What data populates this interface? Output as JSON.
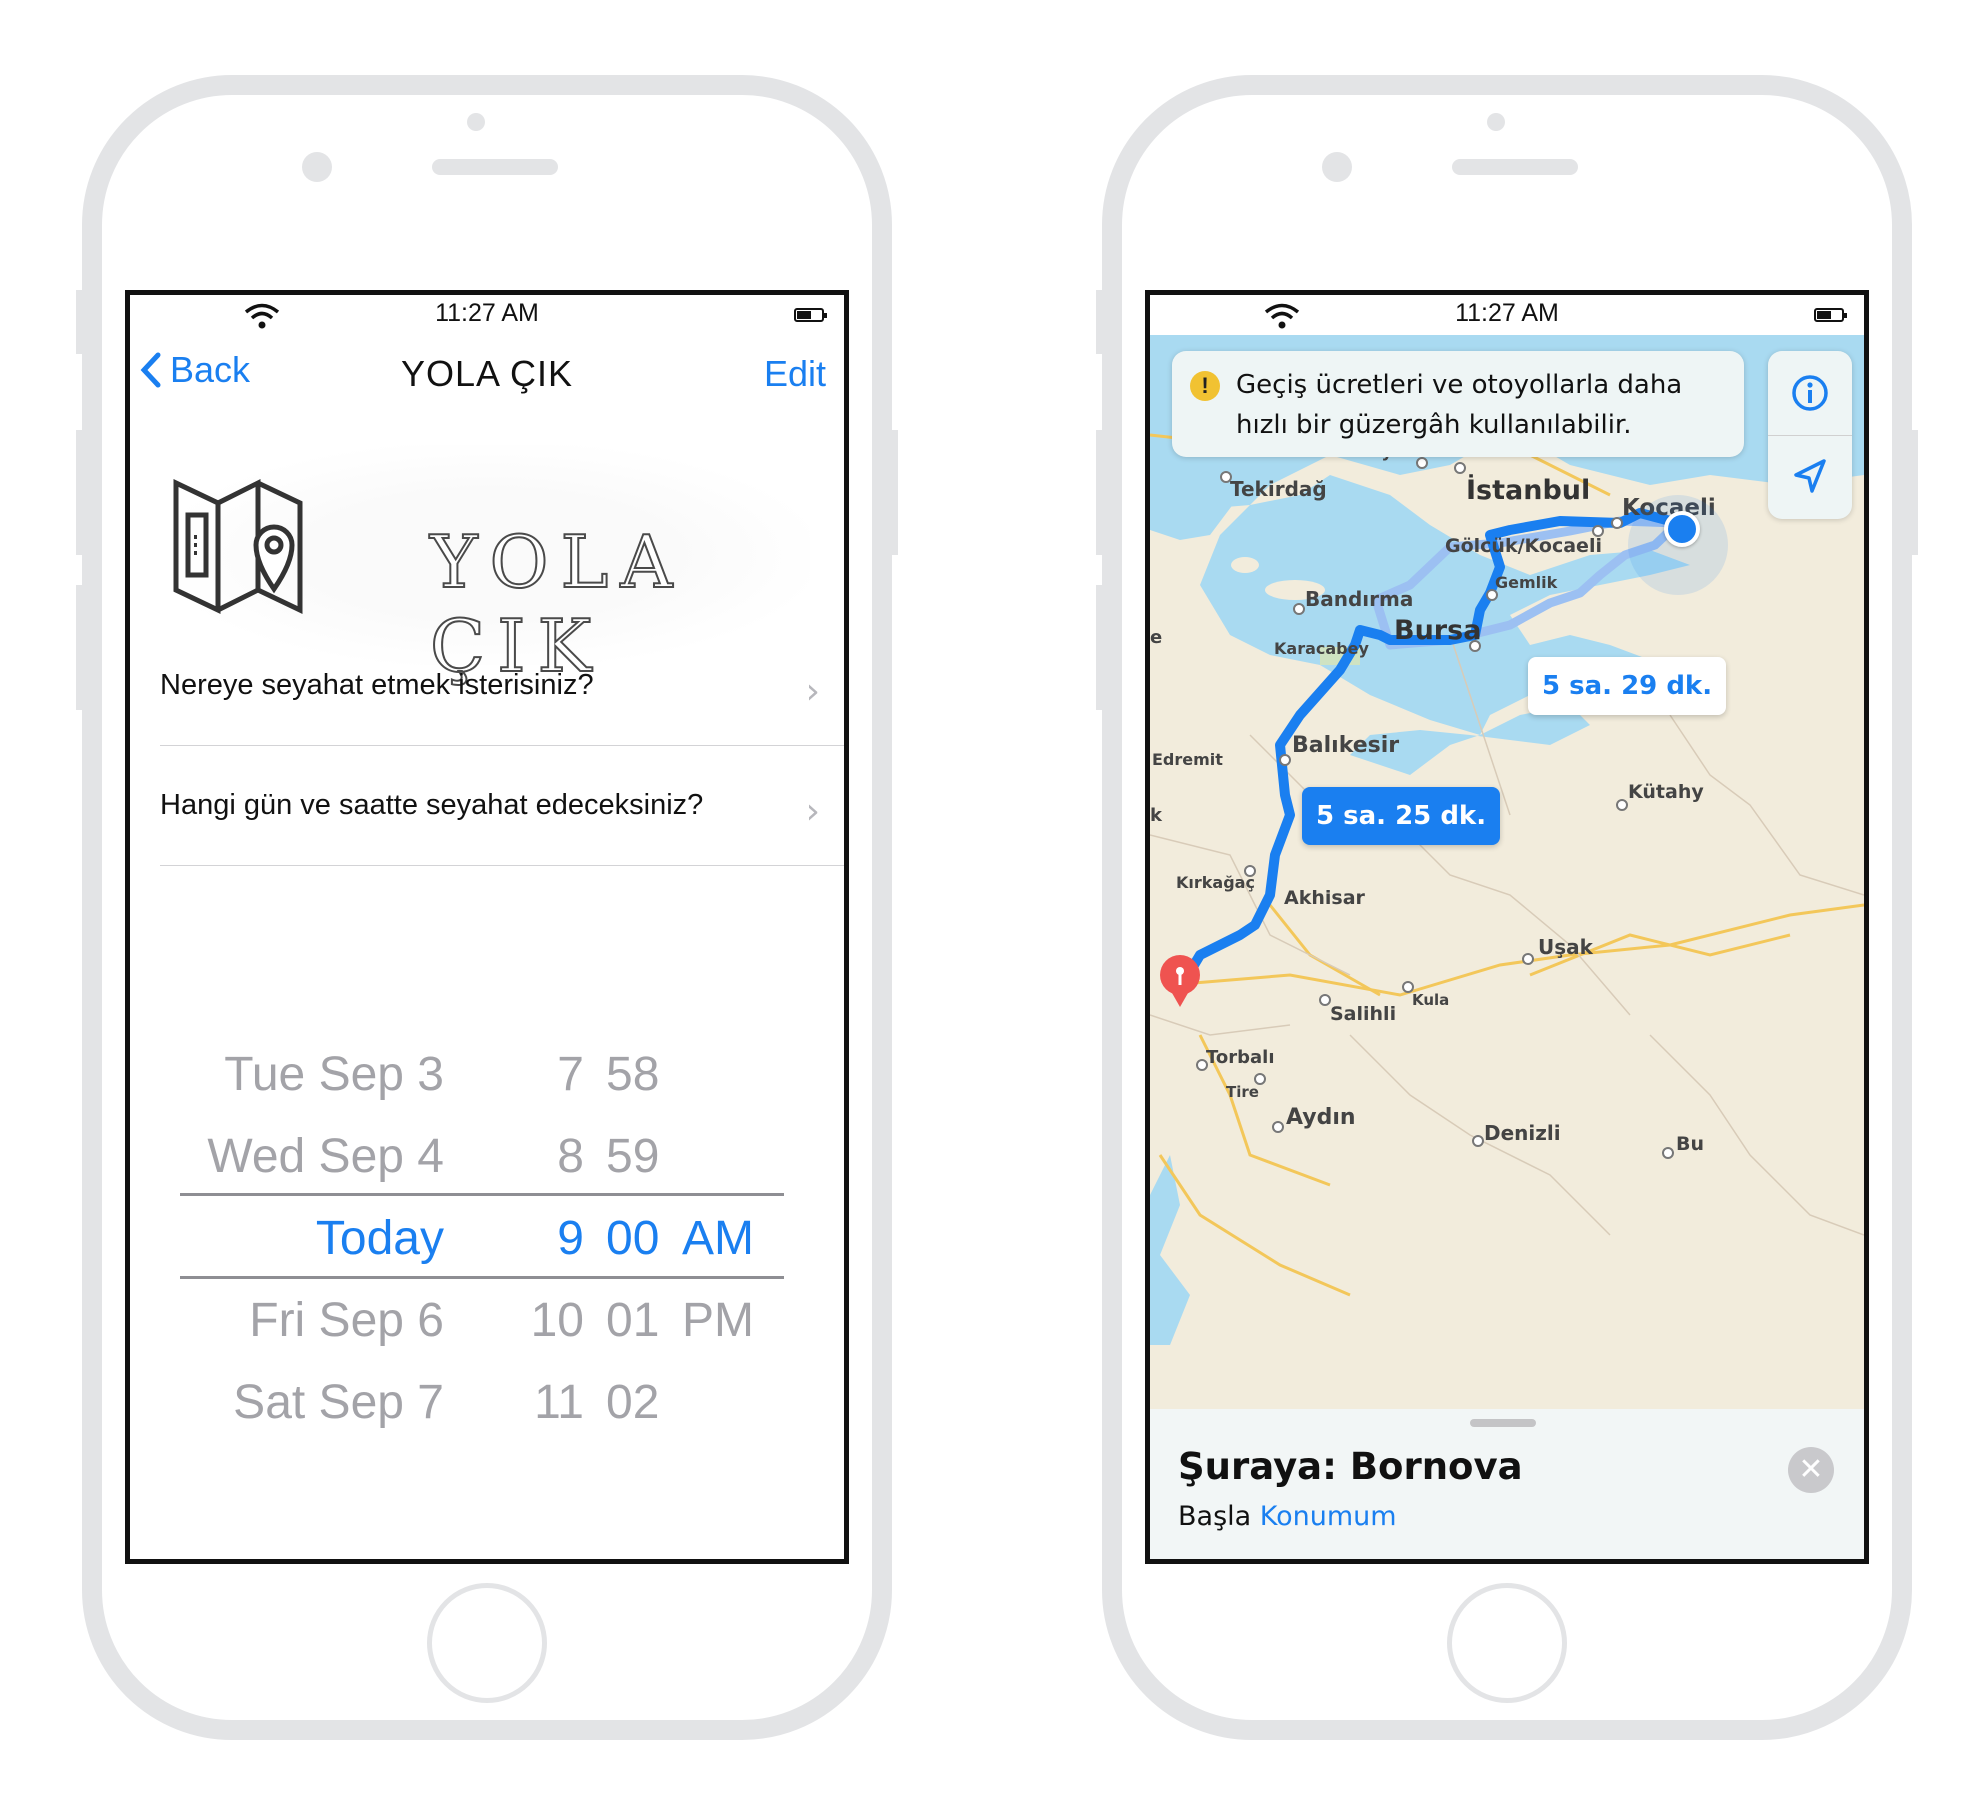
{
  "left_phone": {
    "status": {
      "time": "11:27 AM"
    },
    "nav": {
      "back": "Back",
      "title": "YOLA ÇIK",
      "edit": "Edit"
    },
    "logo": {
      "text": "YOLA ÇIK",
      "icon": "folded-map-pin-icon"
    },
    "rows": [
      {
        "label": "Nereye seyahat etmek isterisiniz?"
      },
      {
        "label": "Hangi gün ve saatte seyahat edeceksiniz?"
      }
    ],
    "picker": {
      "rows": [
        {
          "day": "Tue Sep 3",
          "hour": "7",
          "minute": "58",
          "ampm": ""
        },
        {
          "day": "Wed Sep 4",
          "hour": "8",
          "minute": "59",
          "ampm": ""
        },
        {
          "day": "Today",
          "hour": "9",
          "minute": "00",
          "ampm": "AM"
        },
        {
          "day": "Fri Sep 6",
          "hour": "10",
          "minute": "01",
          "ampm": "PM"
        },
        {
          "day": "Sat Sep 7",
          "hour": "11",
          "minute": "02",
          "ampm": ""
        }
      ]
    }
  },
  "right_phone": {
    "status": {
      "time": "11:27 AM"
    },
    "banner": {
      "text": "Geçiş ücretleri ve otoyollarla daha hızlı bir güzergâh kullanılabilir.",
      "icon": "warning-icon"
    },
    "controls": {
      "info_icon": "info-icon",
      "locate_icon": "location-arrow-icon"
    },
    "routes": [
      {
        "label": "5 sa. 25 dk.",
        "selected": true
      },
      {
        "label": "5 sa. 29 dk.",
        "selected": false
      }
    ],
    "places": {
      "esenyurt": "Esenyurt",
      "tekirdag": "Tekirdağ",
      "istanbul": "İstanbul",
      "kocaeli": "Kocaeli",
      "golcuk": "Gölcük/Kocaeli",
      "gemlik": "Gemlik",
      "bandirma": "Bandırma",
      "bursa": "Bursa",
      "karacabey": "Karacabey",
      "balikesir": "Balıkesir",
      "edremit": "Edremit",
      "kutahya": "Kütahy",
      "kirkagac": "Kırkağaç",
      "akhisar": "Akhisar",
      "usak": "Uşak",
      "salihli": "Salihli",
      "kula": "Kula",
      "torbali": "Torbalı",
      "tire": "Tire",
      "aydin": "Aydın",
      "denizli": "Denizli",
      "bu": "Bu",
      "e_edge": "e",
      "k_edge": "k"
    },
    "sheet": {
      "destination": "Şuraya: Bornova",
      "start_label": "Başla",
      "start_value": "Konumum"
    }
  }
}
